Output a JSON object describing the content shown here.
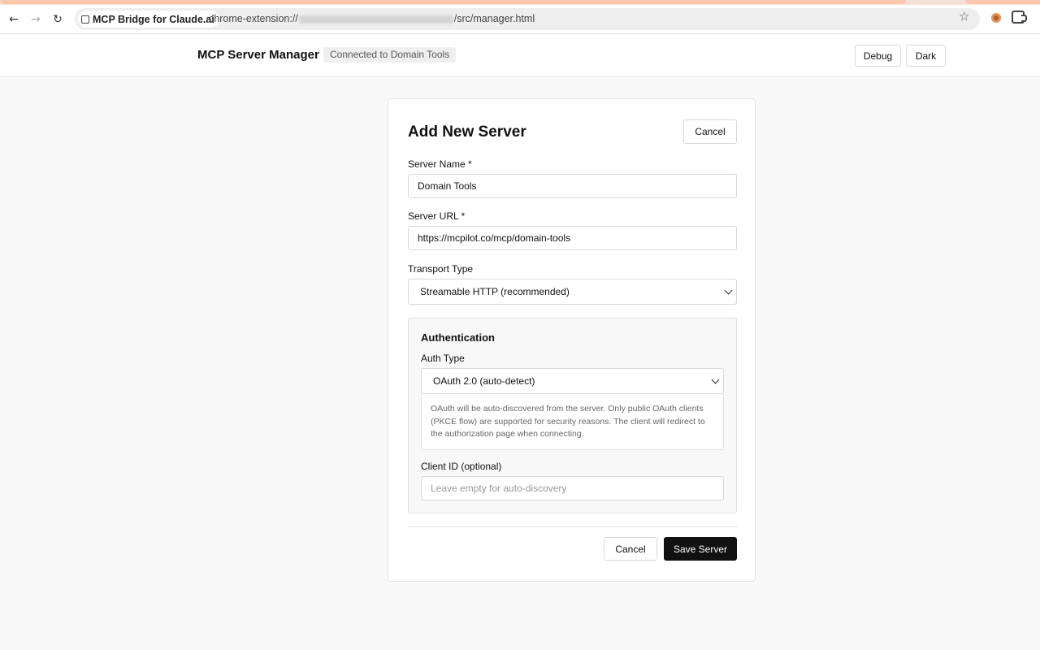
{
  "browser": {
    "tab_title": "MCP Bridge for Claude.ai",
    "url_prefix": "chrome-extension://",
    "url_suffix": "/src/manager.html",
    "icons": {
      "back": "back-arrow-icon",
      "forward": "forward-arrow-icon",
      "reload": "reload-icon",
      "bookmark": "star-icon",
      "extension": "claude-extension-icon",
      "extensions": "puzzle-icon"
    }
  },
  "header": {
    "title": "MCP Server Manager",
    "status": "Connected to Domain Tools",
    "debug_label": "Debug",
    "dark_label": "Dark"
  },
  "form": {
    "title": "Add New Server",
    "cancel_label": "Cancel",
    "server_name": {
      "label": "Server Name *",
      "value": "Domain Tools"
    },
    "server_url": {
      "label": "Server URL *",
      "value": "https://mcpilot.co/mcp/domain-tools"
    },
    "transport": {
      "label": "Transport Type",
      "selected": "Streamable HTTP (recommended)"
    },
    "auth": {
      "title": "Authentication",
      "type_label": "Auth Type",
      "type_selected": "OAuth 2.0 (auto-detect)",
      "help": "OAuth will be auto-discovered from the server. Only public OAuth clients (PKCE flow) are supported for security reasons. The client will redirect to the authorization page when connecting.",
      "client_id_label": "Client ID (optional)",
      "client_id_value": "",
      "client_id_placeholder": "Leave empty for auto-discovery"
    },
    "footer": {
      "cancel_label": "Cancel",
      "save_label": "Save Server"
    }
  },
  "colors": {
    "accent": "#111111",
    "page_bg": "#f8f8f8",
    "chrome_accent": "#f9c8ad"
  }
}
